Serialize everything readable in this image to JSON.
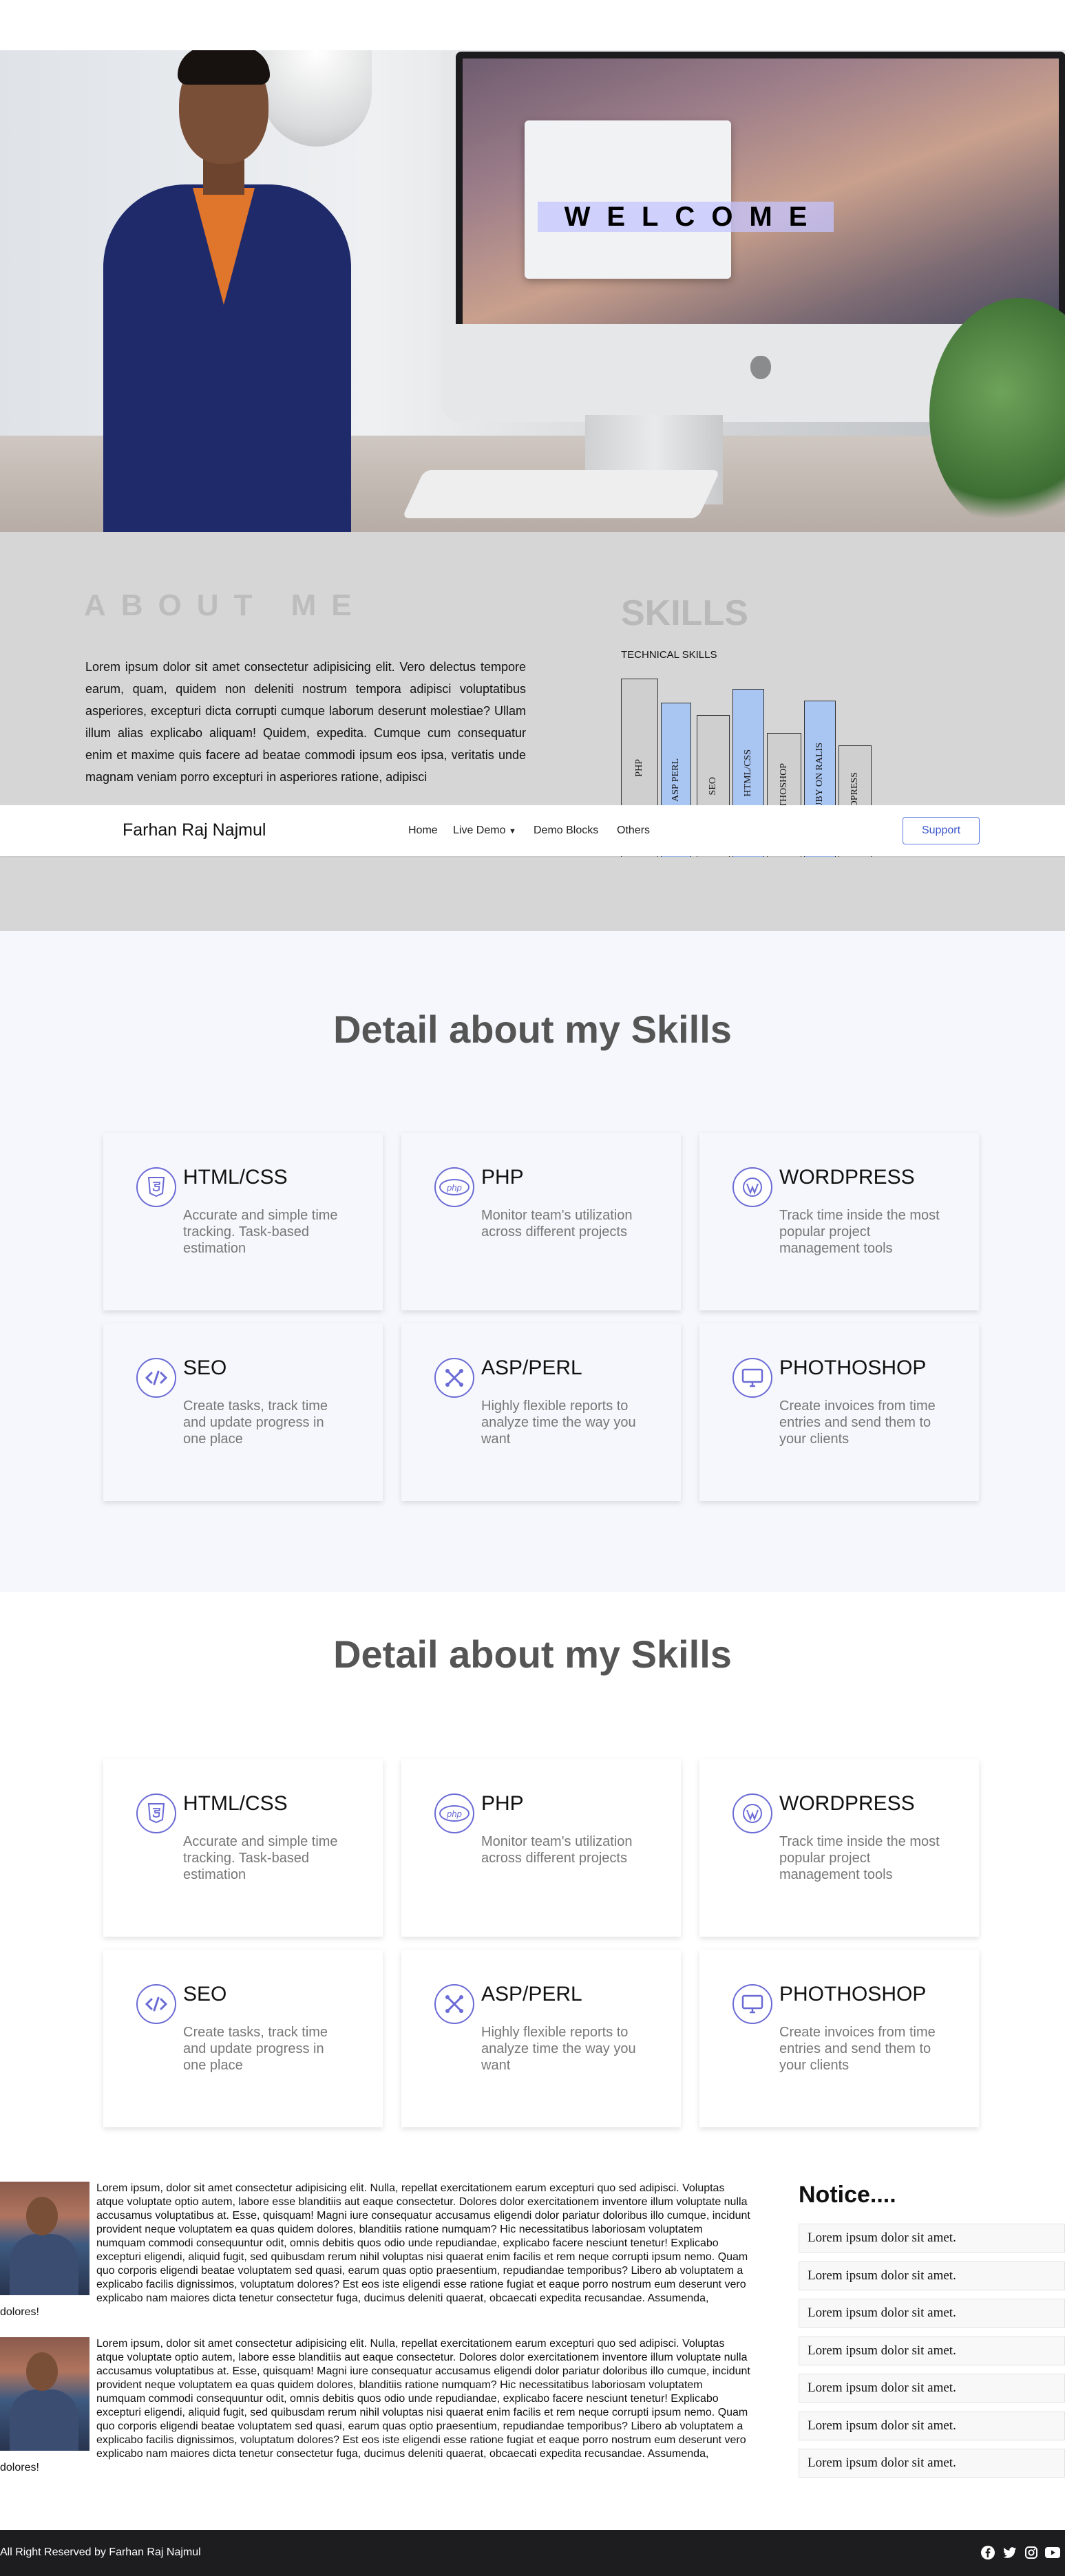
{
  "hero": {
    "welcome": "WELCOME"
  },
  "about": {
    "title": "ABOUT ME",
    "text": "Lorem ipsum dolor sit amet consectetur adipisicing elit. Vero delectus tempore earum, quam, quidem non deleniti nostrum tempora adipisci voluptatibus asperiores, excepturi dicta corrupti cumque laborum deserunt molestiae? Ullam illum alias explicabo aliquam! Quidem, expedita. Cumque cum consequatur enim et maxime quis facere ad beatae commodi ipsum eos ipsa, veritatis unde magnam veniam porro excepturi in asperiores ratione, adipisci"
  },
  "skills_chart": {
    "title": "SKILLS",
    "subtitle": "TECHNICAL SKILLS",
    "books": [
      {
        "label": "PHP",
        "color": "#cfcfcf"
      },
      {
        "label": "ASP PERL",
        "color": "#a9c5f2"
      },
      {
        "label": "SEO",
        "color": "#cfcfcf"
      },
      {
        "label": "HTML/CSS",
        "color": "#a9c5f2"
      },
      {
        "label": "PHOTHOSHOP",
        "color": "#cfcfcf"
      },
      {
        "label": "RUBY ON RALIS",
        "color": "#a9c5f2"
      },
      {
        "label": "WORDPRESS",
        "color": "#cfcfcf"
      }
    ]
  },
  "navbar": {
    "brand": "Farhan Raj Najmul",
    "items": [
      "Home",
      "Live Demo",
      "Demo Blocks",
      "Others"
    ],
    "support": "Support"
  },
  "skills_sections": [
    {
      "title": "Detail about my Skills"
    },
    {
      "title": "Detail about my Skills"
    }
  ],
  "cards": [
    {
      "icon": "html5-icon",
      "title": "HTML/CSS",
      "text": "Accurate and simple time tracking. Task-based estimation"
    },
    {
      "icon": "php-icon",
      "title": "PHP",
      "text": " Monitor team's utilization across different projects"
    },
    {
      "icon": "wordpress-icon",
      "title": "WORDPRESS",
      "text": "Track time inside the most popular project management tools"
    },
    {
      "icon": "code-icon",
      "title": " SEO",
      "text": " Create tasks, track time and update progress in one place"
    },
    {
      "icon": "joomla-icon",
      "title": "ASP/PERL",
      "text": "Highly flexible reports to analyze time the way you want"
    },
    {
      "icon": "monitor-icon",
      "title": " PHOTHOSHOP",
      "text": " Create invoices from time entries and send them to your clients"
    }
  ],
  "posts": [
    {
      "text": "Lorem ipsum, dolor sit amet consectetur adipisicing elit. Nulla, repellat exercitationem earum excepturi quo sed adipisci. Voluptas atque voluptate optio autem, labore esse blanditiis aut eaque consectetur. Dolores dolor exercitationem inventore illum voluptate nulla accusamus voluptatibus at. Esse, quisquam! Magni iure consequatur accusamus eligendi dolor pariatur doloribus illo cumque, incidunt provident neque voluptatem ea quas quidem dolores, blanditiis ratione numquam? Hic necessitatibus laboriosam voluptatem numquam commodi consequuntur odit, omnis debitis quos odio unde repudiandae, explicabo facere nesciunt tenetur! Explicabo excepturi eligendi, aliquid fugit, sed quibusdam rerum nihil voluptas nisi quaerat enim facilis et rem neque corrupti ipsum nemo. Quam quo corporis eligendi beatae voluptatem sed quasi, earum quas optio praesentium, repudiandae temporibus? Libero ab voluptatem a explicabo facilis dignissimos, voluptatum dolores? Est eos iste eligendi esse ratione fugiat et eaque porro nostrum eum deserunt vero explicabo nam maiores dicta tenetur consectetur fuga, ducimus deleniti quaerat, obcaecati expedita recusandae. Assumenda, dolores!"
    },
    {
      "text": "Lorem ipsum, dolor sit amet consectetur adipisicing elit. Nulla, repellat exercitationem earum excepturi quo sed adipisci. Voluptas atque voluptate optio autem, labore esse blanditiis aut eaque consectetur. Dolores dolor exercitationem inventore illum voluptate nulla accusamus voluptatibus at. Esse, quisquam! Magni iure consequatur accusamus eligendi dolor pariatur doloribus illo cumque, incidunt provident neque voluptatem ea quas quidem dolores, blanditiis ratione numquam? Hic necessitatibus laboriosam voluptatem numquam commodi consequuntur odit, omnis debitis quos odio unde repudiandae, explicabo facere nesciunt tenetur! Explicabo excepturi eligendi, aliquid fugit, sed quibusdam rerum nihil voluptas nisi quaerat enim facilis et rem neque corrupti ipsum nemo. Quam quo corporis eligendi beatae voluptatem sed quasi, earum quas optio praesentium, repudiandae temporibus? Libero ab voluptatem a explicabo facilis dignissimos, voluptatum dolores? Est eos iste eligendi esse ratione fugiat et eaque porro nostrum eum deserunt vero explicabo nam maiores dicta tenetur consectetur fuga, ducimus deleniti quaerat, obcaecati expedita recusandae. Assumenda, dolores!"
    }
  ],
  "notice": {
    "title": "Notice....",
    "items": [
      "Lorem ipsum dolor sit amet.",
      "Lorem ipsum dolor sit amet.",
      "Lorem ipsum dolor sit amet.",
      "Lorem ipsum dolor sit amet.",
      "Lorem ipsum dolor sit amet.",
      "Lorem ipsum dolor sit amet.",
      "Lorem ipsum dolor sit amet."
    ]
  },
  "footer": {
    "copyright": "All Right Reserved by Farhan Raj Najmul",
    "social": [
      "facebook-icon",
      "twitter-icon",
      "instagram-icon",
      "youtube-icon"
    ]
  },
  "colors": {
    "accent": "#6b6bd6",
    "welcome_bg": "#c4c4ff",
    "about_bg": "#d6d6d6",
    "footer_bg": "#1d1d1f"
  }
}
